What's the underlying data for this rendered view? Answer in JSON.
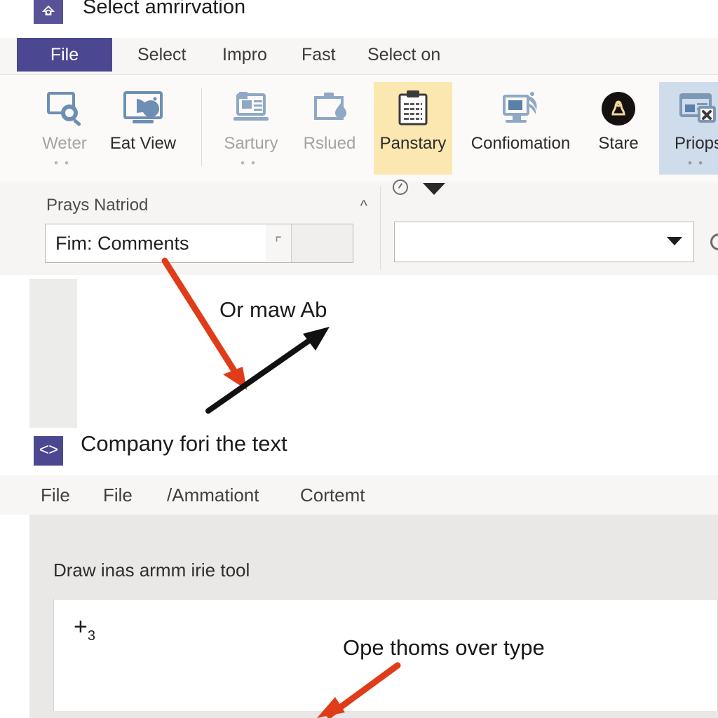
{
  "window": {
    "title": "Select amrirvation",
    "app_icon": "app-logo-icon"
  },
  "menubar": {
    "items": [
      {
        "label": "File",
        "active": true
      },
      {
        "label": "Select",
        "active": false
      },
      {
        "label": "Impro",
        "active": false
      },
      {
        "label": "Fast",
        "active": false
      },
      {
        "label": "Select on",
        "active": false
      }
    ]
  },
  "ribbon": {
    "groups": [
      {
        "tiles": [
          {
            "label": "Weter",
            "icon": "zoom-window-icon",
            "state": "disabled",
            "dropdown": true
          },
          {
            "label": "Eat View",
            "icon": "presentation-chart-icon",
            "state": "normal",
            "dropdown": false
          }
        ]
      },
      {
        "tiles": [
          {
            "label": "Sartury",
            "icon": "laptop-screen-icon",
            "state": "disabled",
            "dropdown": true
          },
          {
            "label": "Rslued",
            "icon": "clipboard-drop-icon",
            "state": "disabled",
            "dropdown": false
          },
          {
            "label": "Panstary",
            "icon": "clipboard-list-icon",
            "state": "highlighted",
            "dropdown": false
          },
          {
            "label": "Confiomation",
            "icon": "monitor-stack-icon",
            "state": "normal",
            "dropdown": false
          },
          {
            "label": "Stare",
            "icon": "black-circle-badge-icon",
            "state": "normal",
            "dropdown": false
          },
          {
            "label": "Priops",
            "icon": "close-window-icon",
            "state": "selected",
            "dropdown": true
          }
        ]
      }
    ],
    "highlight_color": "#fbe7b0",
    "selected_color": "#cfdcec"
  },
  "properties": {
    "section_title": "Prays Natriod",
    "collapse_icon": "chevron-up-icon",
    "field_value": "Fim: Comments",
    "field_caret_icon": "text-cursor-icon",
    "help_icon": "help-circle-icon",
    "expand_icon": "triangle-down-icon",
    "dropdown_value": "",
    "dropdown_placeholder": "",
    "dropdown_arrow_icon": "chevron-down-icon",
    "edge_icon": "circle-icon"
  },
  "annotations": {
    "note_top": "Or maw Ab",
    "note_bottom": "Ope thoms over type",
    "arrow_color_red": "#e03c19",
    "arrow_color_black": "#111111"
  },
  "document2": {
    "icon": "code-brackets-icon",
    "title": "Company fori the text",
    "tabs": [
      {
        "label": "File"
      },
      {
        "label": "File"
      },
      {
        "label": "/Ammationt"
      },
      {
        "label": "Cortemt"
      }
    ]
  },
  "lower_panel": {
    "label": "Draw inas armm irie tool",
    "marker": "+",
    "marker_sub": "3"
  }
}
